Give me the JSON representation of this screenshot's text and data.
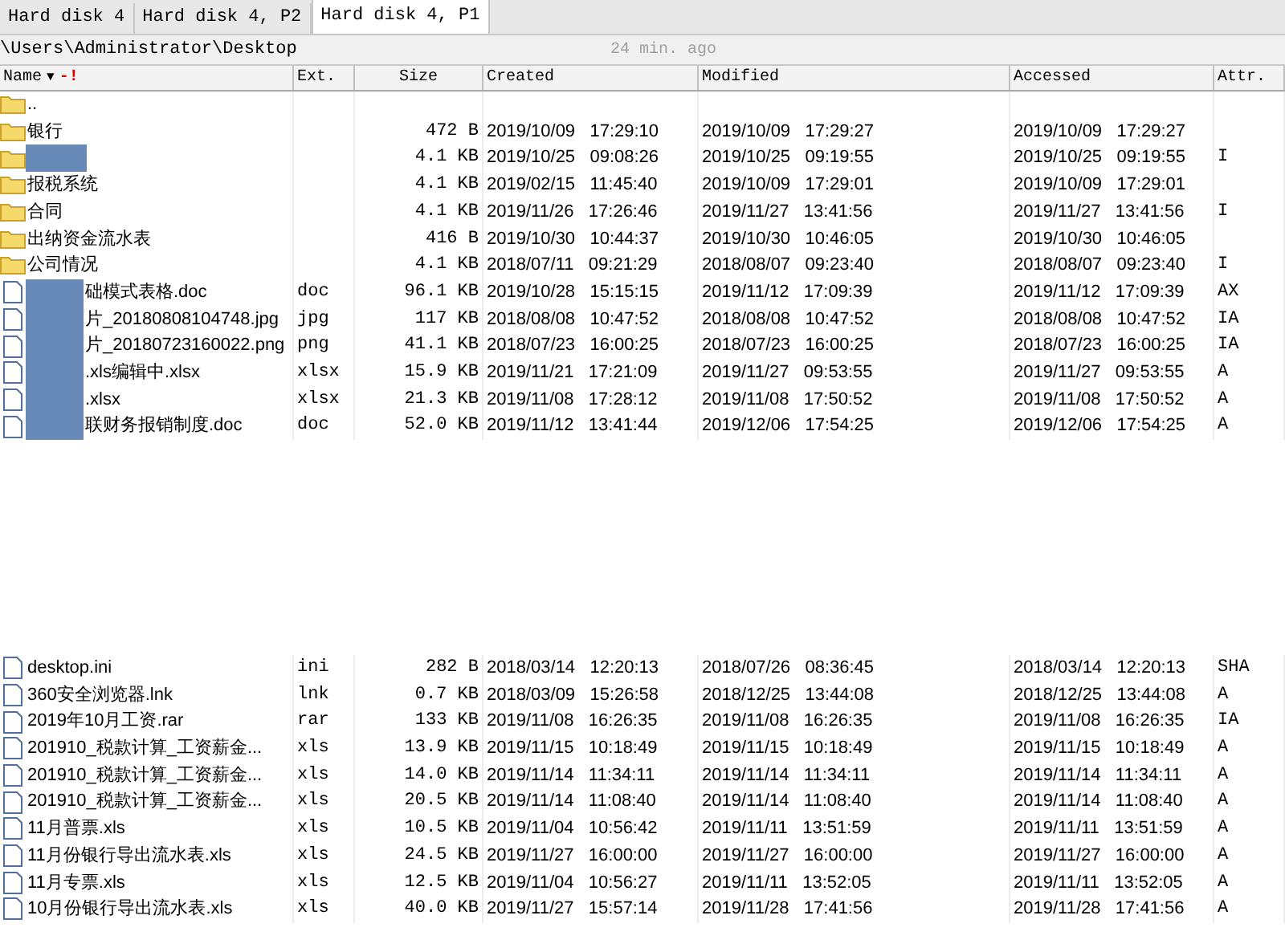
{
  "tabs": [
    {
      "label": "Hard disk 4",
      "selected": false
    },
    {
      "label": "Hard disk 4, P2",
      "selected": false
    },
    {
      "label": "Hard disk 4, P1",
      "selected": true
    }
  ],
  "path": "\\Users\\Administrator\\Desktop",
  "scan_age": "24 min. ago",
  "columns": [
    {
      "label": "Name",
      "sort_mark": "▼",
      "flag": "-!"
    },
    {
      "label": "Ext."
    },
    {
      "label": "Size"
    },
    {
      "label": "Created"
    },
    {
      "label": "Modified"
    },
    {
      "label": "Accessed"
    },
    {
      "label": "Attr."
    }
  ],
  "rows": [
    {
      "kind": "folder",
      "name": ".."
    },
    {
      "kind": "folder",
      "name": "银行",
      "size": "472 B",
      "created": "2019/10/09   17:29:10",
      "modified": "2019/10/09   17:29:27",
      "accessed": "2019/10/09   17:29:27"
    },
    {
      "kind": "folder",
      "redacted": true,
      "size": "4.1 KB",
      "created": "2019/10/25   09:08:26",
      "modified": "2019/10/25   09:19:55",
      "accessed": "2019/10/25   09:19:55",
      "attr": "I"
    },
    {
      "kind": "folder",
      "name": "报税系统",
      "size": "4.1 KB",
      "created": "2019/02/15   11:45:40",
      "modified": "2019/10/09   17:29:01",
      "accessed": "2019/10/09   17:29:01"
    },
    {
      "kind": "folder",
      "name": "合同",
      "size": "4.1 KB",
      "created": "2019/11/26   17:26:46",
      "modified": "2019/11/27   13:41:56",
      "accessed": "2019/11/27   13:41:56",
      "attr": "I"
    },
    {
      "kind": "folder",
      "name": "出纳资金流水表",
      "size": "416 B",
      "created": "2019/10/30   10:44:37",
      "modified": "2019/10/30   10:46:05",
      "accessed": "2019/10/30   10:46:05"
    },
    {
      "kind": "folder",
      "name": "公司情况",
      "size": "4.1 KB",
      "created": "2018/07/11   09:21:29",
      "modified": "2018/08/07   09:23:40",
      "accessed": "2018/08/07   09:23:40",
      "attr": "I"
    },
    {
      "kind": "file",
      "redacted": true,
      "name": "础模式表格.doc",
      "ext": "doc",
      "size": "96.1 KB",
      "created": "2019/10/28   15:15:15",
      "modified": "2019/11/12   17:09:39",
      "accessed": "2019/11/12   17:09:39",
      "attr": "AX"
    },
    {
      "kind": "file",
      "redacted": true,
      "name": "片_20180808104748.jpg",
      "ext": "jpg",
      "size": "117 KB",
      "created": "2018/08/08   10:47:52",
      "modified": "2018/08/08   10:47:52",
      "accessed": "2018/08/08   10:47:52",
      "attr": "IA"
    },
    {
      "kind": "file",
      "redacted": true,
      "name": "片_20180723160022.png",
      "ext": "png",
      "size": "41.1 KB",
      "created": "2018/07/23   16:00:25",
      "modified": "2018/07/23   16:00:25",
      "accessed": "2018/07/23   16:00:25",
      "attr": "IA"
    },
    {
      "kind": "file",
      "redacted": true,
      "name": ".xls编辑中.xlsx",
      "ext": "xlsx",
      "size": "15.9 KB",
      "created": "2019/11/21   17:21:09",
      "modified": "2019/11/27   09:53:55",
      "accessed": "2019/11/27   09:53:55",
      "attr": "A"
    },
    {
      "kind": "file",
      "redacted": true,
      "name": ".xlsx",
      "ext": "xlsx",
      "size": "21.3 KB",
      "created": "2019/11/08   17:28:12",
      "modified": "2019/11/08   17:50:52",
      "accessed": "2019/11/08   17:50:52",
      "attr": "A"
    },
    {
      "kind": "file",
      "redacted": true,
      "name": "联财务报销制度.doc",
      "ext": "doc",
      "size": "52.0 KB",
      "created": "2019/11/12   13:41:44",
      "modified": "2019/12/06   17:54:25",
      "accessed": "2019/12/06   17:54:25",
      "attr": "A"
    }
  ],
  "rows_after_gap": [
    {
      "kind": "file",
      "name": "desktop.ini",
      "ext": "ini",
      "size": "282 B",
      "created": "2018/03/14   12:20:13",
      "modified": "2018/07/26   08:36:45",
      "accessed": "2018/03/14   12:20:13",
      "attr": "SHA"
    },
    {
      "kind": "file",
      "name": "360安全浏览器.lnk",
      "ext": "lnk",
      "size": "0.7 KB",
      "created": "2018/03/09   15:26:58",
      "modified": "2018/12/25   13:44:08",
      "accessed": "2018/12/25   13:44:08",
      "attr": "A"
    },
    {
      "kind": "file",
      "name": "2019年10月工资.rar",
      "ext": "rar",
      "size": "133 KB",
      "created": "2019/11/08   16:26:35",
      "modified": "2019/11/08   16:26:35",
      "accessed": "2019/11/08   16:26:35",
      "attr": "IA"
    },
    {
      "kind": "file",
      "name": "201910_税款计算_工资薪金...",
      "ext": "xls",
      "size": "13.9 KB",
      "created": "2019/11/15   10:18:49",
      "modified": "2019/11/15   10:18:49",
      "accessed": "2019/11/15   10:18:49",
      "attr": "A"
    },
    {
      "kind": "file",
      "name": "201910_税款计算_工资薪金...",
      "ext": "xls",
      "size": "14.0 KB",
      "created": "2019/11/14   11:34:11",
      "modified": "2019/11/14   11:34:11",
      "accessed": "2019/11/14   11:34:11",
      "attr": "A"
    },
    {
      "kind": "file",
      "name": "201910_税款计算_工资薪金...",
      "ext": "xls",
      "size": "20.5 KB",
      "created": "2019/11/14   11:08:40",
      "modified": "2019/11/14   11:08:40",
      "accessed": "2019/11/14   11:08:40",
      "attr": "A"
    },
    {
      "kind": "file",
      "name": "11月普票.xls",
      "ext": "xls",
      "size": "10.5 KB",
      "created": "2019/11/04   10:56:42",
      "modified": "2019/11/11   13:51:59",
      "accessed": "2019/11/11   13:51:59",
      "attr": "A"
    },
    {
      "kind": "file",
      "name": "11月份银行导出流水表.xls",
      "ext": "xls",
      "size": "24.5 KB",
      "created": "2019/11/27   16:00:00",
      "modified": "2019/11/27   16:00:00",
      "accessed": "2019/11/27   16:00:00",
      "attr": "A"
    },
    {
      "kind": "file",
      "name": "11月专票.xls",
      "ext": "xls",
      "size": "12.5 KB",
      "created": "2019/11/04   10:56:27",
      "modified": "2019/11/11   13:52:05",
      "accessed": "2019/11/11   13:52:05",
      "attr": "A"
    },
    {
      "kind": "file",
      "name": "10月份银行导出流水表.xls",
      "ext": "xls",
      "size": "40.0 KB",
      "created": "2019/11/27   15:57:14",
      "modified": "2019/11/28   17:41:56",
      "accessed": "2019/11/28   17:41:56",
      "attr": "A"
    }
  ]
}
